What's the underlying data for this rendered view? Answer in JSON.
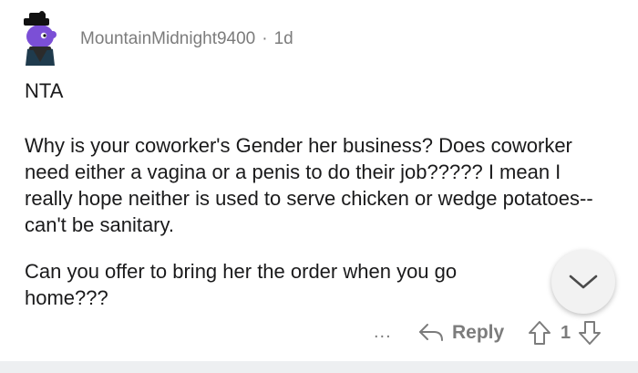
{
  "comment": {
    "author": "MountainMidnight9400",
    "separator": "·",
    "age": "1d",
    "paragraphs": [
      "NTA",
      "Why is your coworker's Gender her business?  Does coworker need either a vagina or a penis to do their job?????  I mean I really hope neither is used to serve chicken or wedge potatoes--can't be sanitary.",
      "Can you offer to bring her the order when you go home???"
    ]
  },
  "actions": {
    "more_label": "...",
    "reply_label": "Reply",
    "score": "1"
  },
  "icons": {
    "avatar": "avatar-icon",
    "collapse": "chevron-down-icon",
    "reply": "reply-arrow-icon",
    "upvote": "upvote-arrow-icon",
    "downvote": "downvote-arrow-icon"
  },
  "colors": {
    "text": "#1a1a1b",
    "meta": "#7c7c7c",
    "avatar_body": "#7b4fd6",
    "collapse_bg": "#f2f2f2"
  }
}
